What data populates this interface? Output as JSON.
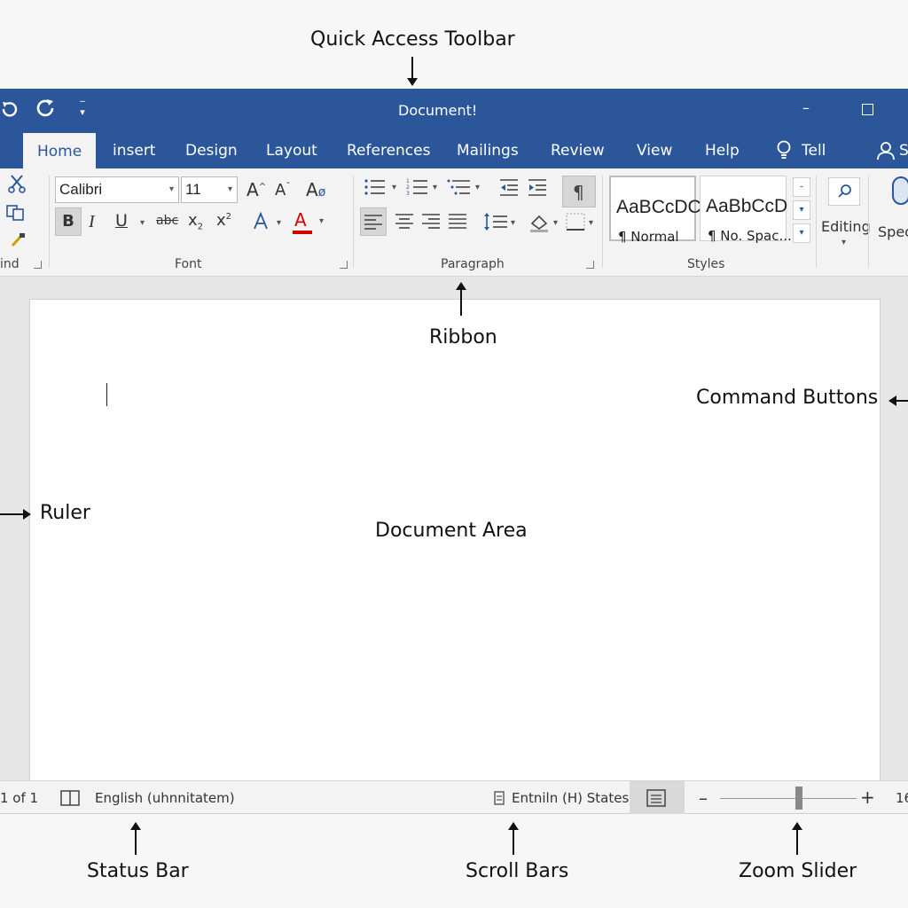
{
  "callouts": {
    "quick_access": "Quick Access Toolbar",
    "ribbon": "Ribbon",
    "command_buttons": "Command Buttons",
    "ruler": "Ruler",
    "document_area": "Document Area",
    "status_bar": "Status Bar",
    "scroll_bars": "Scroll Bars",
    "zoom_slider": "Zoom Slider"
  },
  "titlebar": {
    "title": "Document!",
    "undo_icon": "undo-icon",
    "redo_icon": "redo-icon",
    "customize_icon": "customize-qat-icon",
    "minimize": "–",
    "maximize": "☐"
  },
  "tabs": [
    {
      "label": "Home",
      "active": true
    },
    {
      "label": "insert"
    },
    {
      "label": "Design"
    },
    {
      "label": "Layout"
    },
    {
      "label": "References"
    },
    {
      "label": "Mailings"
    },
    {
      "label": "Review"
    },
    {
      "label": "View"
    },
    {
      "label": "Help"
    },
    {
      "label": "Tell"
    },
    {
      "label": "S"
    }
  ],
  "ribbon": {
    "clipboard": {
      "label": "ind"
    },
    "font": {
      "label": "Font",
      "family": "Calibri",
      "size": "11",
      "grow": "A",
      "shrink": "A",
      "clear": "A",
      "bold": "B",
      "italic": "I",
      "underline": "U",
      "strike": "abc",
      "subscript": "x",
      "superscript": "x",
      "font_color": "A"
    },
    "paragraph": {
      "label": "Paragraph"
    },
    "styles": {
      "label": "Styles",
      "items": [
        {
          "sample": "AaBCcDC",
          "name": "¶ Normal"
        },
        {
          "sample": "AaBbCcD",
          "name": "¶ No. Spac..."
        }
      ]
    },
    "editing": {
      "label": "Editing"
    },
    "speech": {
      "label": "Spec"
    }
  },
  "status": {
    "page": "1 of 1",
    "language": "English (uhnnitatem)",
    "accessibility": "Entniln (H) States)",
    "zoom_minus": "–",
    "zoom_plus": "+",
    "zoom_percent": "16",
    "zoom_level": 0.5
  },
  "colors": {
    "brand": "#2b579a",
    "font_color_bar": "#d00000"
  }
}
